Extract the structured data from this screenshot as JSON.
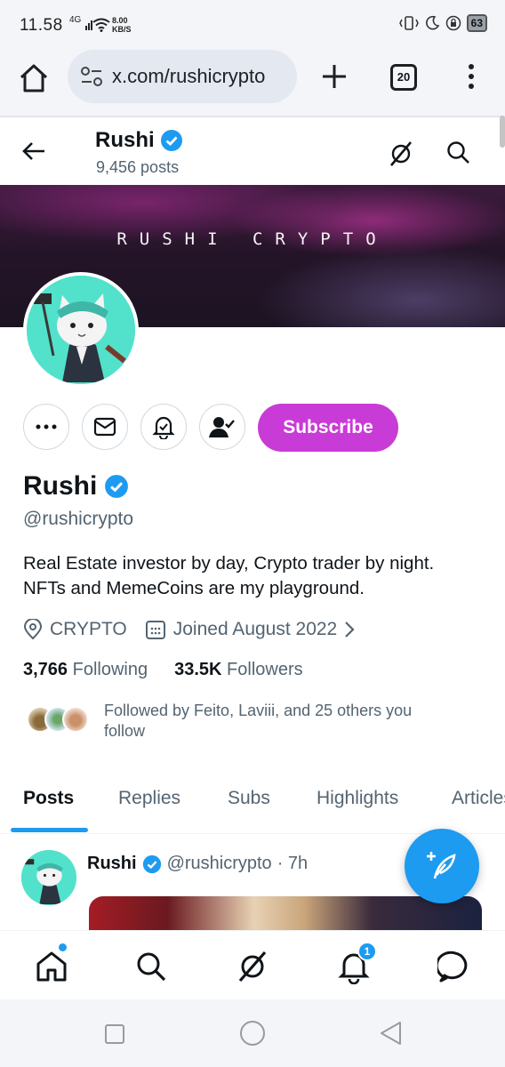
{
  "status_bar": {
    "time": "11.58",
    "network": "4G",
    "speed_value": "8.00",
    "speed_unit": "KB/S",
    "battery": "63"
  },
  "browser": {
    "url": "x.com/rushicrypto",
    "tab_count": "20"
  },
  "profile_header": {
    "name": "Rushi",
    "post_count": "9,456 posts"
  },
  "banner": {
    "title": "RUSHI CRYPTO"
  },
  "actions": {
    "subscribe_label": "Subscribe"
  },
  "profile": {
    "name": "Rushi",
    "handle": "@rushicrypto",
    "bio_lines": [
      "Real Estate investor by day, Crypto trader by night.",
      "NFTs and MemeCoins are my playground."
    ],
    "location": "CRYPTO",
    "joined": "Joined August 2022",
    "following_count": "3,766",
    "following_label": "Following",
    "followers_count": "33.5K",
    "followers_label": "Followers",
    "followed_by_lines": [
      "Followed by Feito, Laviii, and 25 others you",
      "follow"
    ]
  },
  "tabs": [
    "Posts",
    "Replies",
    "Subs",
    "Highlights",
    "Articles"
  ],
  "post": {
    "name": "Rushi",
    "handle": "@rushicrypto",
    "time": "· 7h"
  },
  "bottom_nav": {
    "notifications_badge": "1"
  },
  "colors": {
    "accent": "#1d9bf0",
    "subscribe": "#c93bd6",
    "secondary_text": "#536471"
  }
}
